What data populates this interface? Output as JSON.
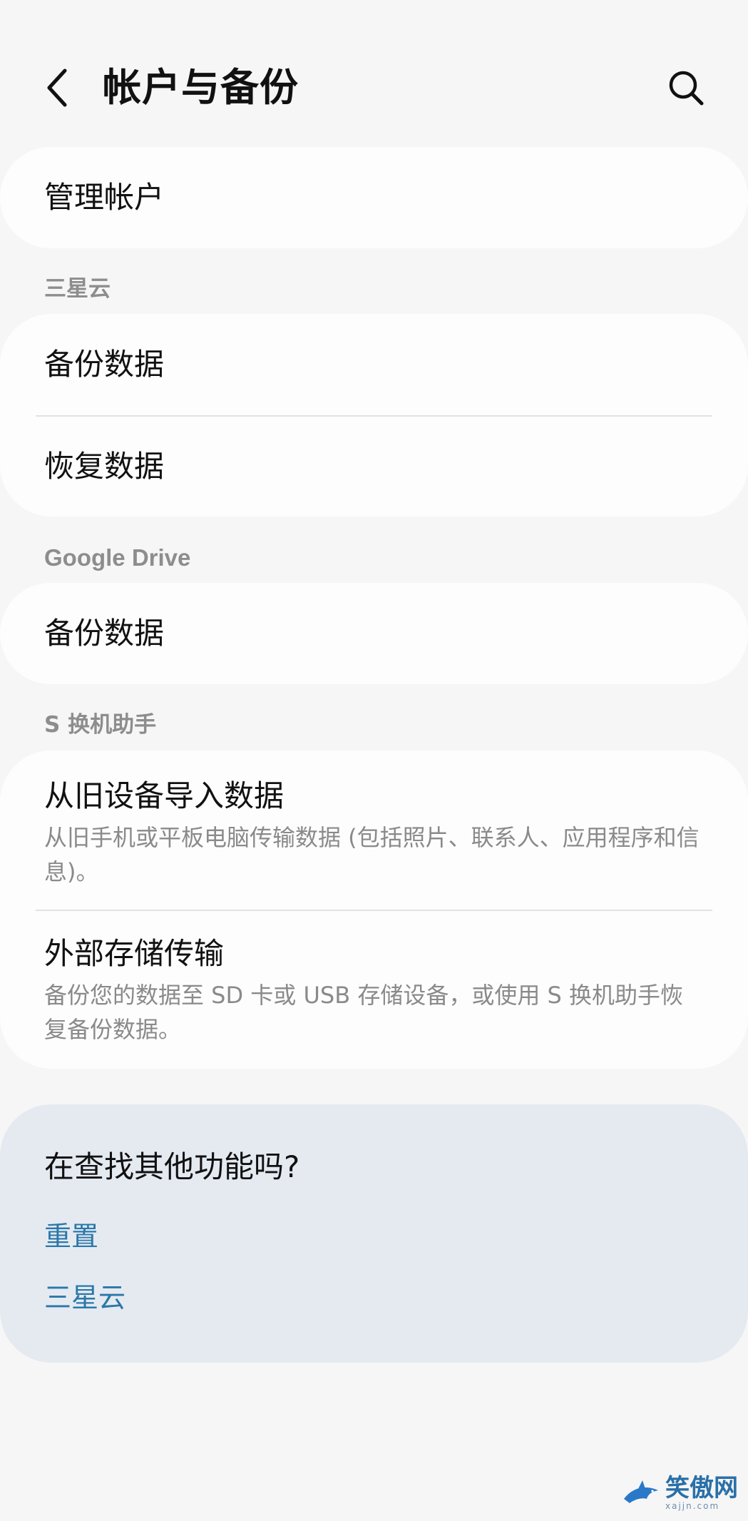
{
  "header": {
    "title": "帐户与备份",
    "back_icon": "chevron-left-icon",
    "search_icon": "search-icon"
  },
  "manage": {
    "label": "管理帐户"
  },
  "samsung_cloud": {
    "section_label": "三星云",
    "items": [
      {
        "label": "备份数据"
      },
      {
        "label": "恢复数据"
      }
    ]
  },
  "google_drive": {
    "section_label": "Google Drive",
    "items": [
      {
        "label": "备份数据"
      }
    ]
  },
  "smart_switch": {
    "section_label": "S 换机助手",
    "items": [
      {
        "label": "从旧设备导入数据",
        "description": "从旧手机或平板电脑传输数据 (包括照片、联系人、应用程序和信息)。"
      },
      {
        "label": "外部存储传输",
        "description": "备份您的数据至 SD 卡或 USB 存储设备，或使用 S 换机助手恢复备份数据。"
      }
    ]
  },
  "suggestions": {
    "title": "在查找其他功能吗?",
    "links": [
      {
        "label": "重置"
      },
      {
        "label": "三星云"
      }
    ]
  },
  "watermark": {
    "text": "笑傲网",
    "sub": "xajjn.com"
  },
  "colors": {
    "background": "#f6f6f6",
    "card": "#fdfdfd",
    "suggestion_card": "#e5eaf1",
    "link": "#2a78a8",
    "secondary_text": "#8a8a8a"
  }
}
